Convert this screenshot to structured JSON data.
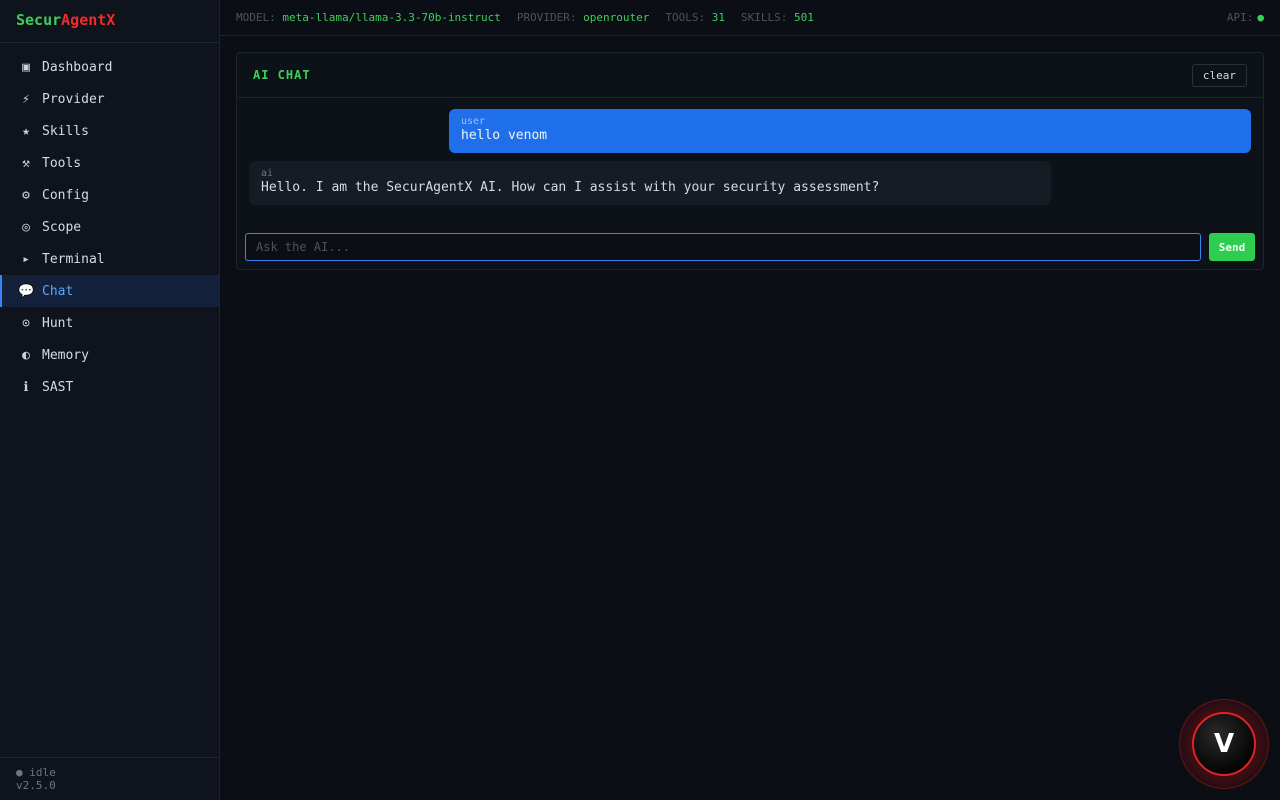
{
  "logo": {
    "part1": "Secur",
    "part2": "AgentX"
  },
  "sidebar": {
    "items": [
      {
        "icon": "▣",
        "icon_name": "dashboard-icon",
        "label": "Dashboard"
      },
      {
        "icon": "⚡",
        "icon_name": "lightning-icon",
        "label": "Provider"
      },
      {
        "icon": "★",
        "icon_name": "star-icon",
        "label": "Skills"
      },
      {
        "icon": "⚒",
        "icon_name": "hammer-icon",
        "label": "Tools"
      },
      {
        "icon": "⚙",
        "icon_name": "gear-icon",
        "label": "Config"
      },
      {
        "icon": "◎",
        "icon_name": "target-icon",
        "label": "Scope"
      },
      {
        "icon": "▸",
        "icon_name": "terminal-icon",
        "label": "Terminal"
      },
      {
        "icon": "💬",
        "icon_name": "chat-bubble-icon",
        "label": "Chat"
      },
      {
        "icon": "⊙",
        "icon_name": "crosshair-icon",
        "label": "Hunt"
      },
      {
        "icon": "◐",
        "icon_name": "half-circle-icon",
        "label": "Memory"
      },
      {
        "icon": "ℹ",
        "icon_name": "info-icon",
        "label": "SAST"
      }
    ],
    "active_index": 7,
    "status": "● idle",
    "version": "v2.5.0"
  },
  "topbar": {
    "model_label": "MODEL:",
    "model_value": "meta-llama/llama-3.3-70b-instruct",
    "provider_label": "PROVIDER:",
    "provider_value": "openrouter",
    "tools_label": "TOOLS:",
    "tools_value": "31",
    "skills_label": "SKILLS:",
    "skills_value": "501",
    "api_label": "API:",
    "api_status": "●"
  },
  "chat": {
    "title": "AI CHAT",
    "clear_label": "clear",
    "messages": [
      {
        "role": "user",
        "text": "hello venom"
      },
      {
        "role": "ai",
        "text": "Hello. I am the SecurAgentX AI. How can I assist with your security assessment?"
      }
    ],
    "input_placeholder": "Ask the AI...",
    "input_value": "",
    "send_label": "Send"
  },
  "fab": {
    "letter": "V"
  },
  "colors": {
    "accent_green": "#3ecf5a",
    "accent_red": "#ef2b2b",
    "accent_blue": "#1f6feb"
  }
}
